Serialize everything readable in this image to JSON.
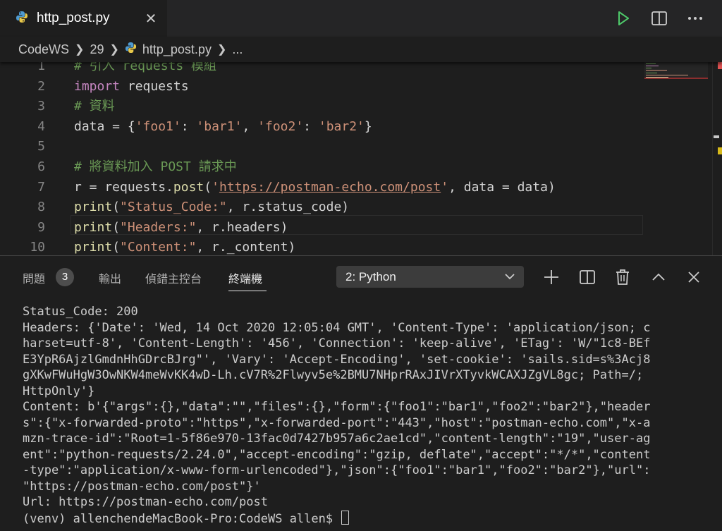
{
  "tab": {
    "title": "http_post.py",
    "close": "✕"
  },
  "breadcrumb": {
    "parts": [
      "CodeWS",
      "29",
      "http_post.py",
      "..."
    ]
  },
  "editor": {
    "lines": [
      {
        "no": "1",
        "tokens": [
          {
            "t": "# 引入 requests 模組",
            "c": "cm"
          }
        ]
      },
      {
        "no": "2",
        "tokens": [
          {
            "t": "import",
            "c": "kw"
          },
          {
            "t": " requests",
            "c": ""
          }
        ]
      },
      {
        "no": "3",
        "tokens": [
          {
            "t": "# 資料",
            "c": "cm"
          }
        ]
      },
      {
        "no": "4",
        "tokens": [
          {
            "t": "data = {",
            "c": ""
          },
          {
            "t": "'foo1'",
            "c": "str"
          },
          {
            "t": ": ",
            "c": ""
          },
          {
            "t": "'bar1'",
            "c": "str"
          },
          {
            "t": ", ",
            "c": ""
          },
          {
            "t": "'foo2'",
            "c": "str"
          },
          {
            "t": ": ",
            "c": ""
          },
          {
            "t": "'bar2'",
            "c": "str"
          },
          {
            "t": "}",
            "c": ""
          }
        ]
      },
      {
        "no": "5",
        "tokens": []
      },
      {
        "no": "6",
        "tokens": [
          {
            "t": "# 將資料加入 POST 請求中",
            "c": "cm"
          }
        ]
      },
      {
        "no": "7",
        "tokens": [
          {
            "t": "r = requests.",
            "c": ""
          },
          {
            "t": "post",
            "c": "fn"
          },
          {
            "t": "(",
            "c": ""
          },
          {
            "t": "'",
            "c": "str"
          },
          {
            "t": "https://postman-echo.com/post",
            "c": "str link"
          },
          {
            "t": "'",
            "c": "str"
          },
          {
            "t": ", data = data)",
            "c": ""
          }
        ]
      },
      {
        "no": "8",
        "tokens": [
          {
            "t": "print",
            "c": "fn"
          },
          {
            "t": "(",
            "c": ""
          },
          {
            "t": "\"Status_Code:\"",
            "c": "str"
          },
          {
            "t": ", r.status_code)",
            "c": ""
          }
        ]
      },
      {
        "no": "9",
        "tokens": [
          {
            "t": "print",
            "c": "fn"
          },
          {
            "t": "(",
            "c": ""
          },
          {
            "t": "\"Headers:\"",
            "c": "str"
          },
          {
            "t": ", r.headers)",
            "c": ""
          }
        ]
      },
      {
        "no": "10",
        "tokens": [
          {
            "t": "print",
            "c": "fn"
          },
          {
            "t": "(",
            "c": ""
          },
          {
            "t": "\"Content:\"",
            "c": "str"
          },
          {
            "t": ", r._content)",
            "c": ""
          }
        ]
      }
    ]
  },
  "panel": {
    "tabs": [
      {
        "label": "問題"
      },
      {
        "label": "輸出"
      },
      {
        "label": "偵錯主控台"
      },
      {
        "label": "終端機"
      }
    ],
    "problems_count": "3",
    "terminal_selector": "2: Python"
  },
  "terminal": {
    "lines": [
      "Status_Code: 200",
      "Headers: {'Date': 'Wed, 14 Oct 2020 12:05:04 GMT', 'Content-Type': 'application/json; c",
      "harset=utf-8', 'Content-Length': '456', 'Connection': 'keep-alive', 'ETag': 'W/\"1c8-BEf",
      "E3YpR6AjzlGmdnHhGDrcBJrg\"', 'Vary': 'Accept-Encoding', 'set-cookie': 'sails.sid=s%3Acj8",
      "gXKwFWuHgW3OwNKW4meWvKK4wD-Lh.cV7R%2Flwyv5e%2BMU7NHprRAxJIVrXTyvkWCAXJZgVL8gc; Path=/;",
      "HttpOnly'}",
      "Content: b'{\"args\":{},\"data\":\"\",\"files\":{},\"form\":{\"foo1\":\"bar1\",\"foo2\":\"bar2\"},\"header",
      "s\":{\"x-forwarded-proto\":\"https\",\"x-forwarded-port\":\"443\",\"host\":\"postman-echo.com\",\"x-a",
      "mzn-trace-id\":\"Root=1-5f86e970-13fac0d7427b957a6c2ae1cd\",\"content-length\":\"19\",\"user-ag",
      "ent\":\"python-requests/2.24.0\",\"accept-encoding\":\"gzip, deflate\",\"accept\":\"*/*\",\"content",
      "-type\":\"application/x-www-form-urlencoded\"},\"json\":{\"foo1\":\"bar1\",\"foo2\":\"bar2\"},\"url\":",
      "\"https://postman-echo.com/post\"}'",
      "Url: https://postman-echo.com/post"
    ],
    "prompt": "(venv) allenchendeMacBook-Pro:CodeWS allen$ "
  }
}
